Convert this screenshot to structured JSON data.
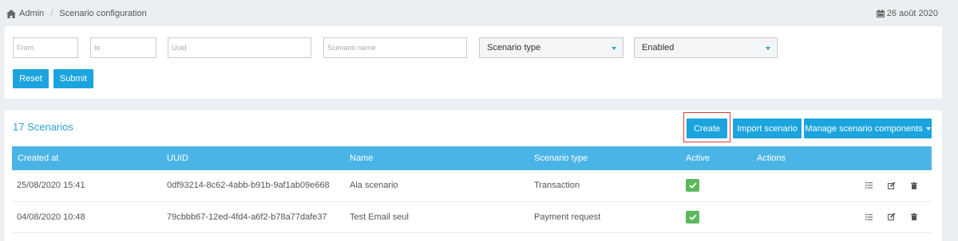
{
  "breadcrumb": {
    "home": "Admin",
    "current": "Scenario configuration"
  },
  "date": "26 août 2020",
  "filters": {
    "from_placeholder": "From",
    "to_placeholder": "to",
    "uuid_placeholder": "Uuid",
    "name_placeholder": "Scenario name",
    "scenario_type": "Scenario type",
    "enabled": "Enabled",
    "reset_label": "Reset",
    "submit_label": "Submit"
  },
  "scenarios": {
    "title": "17 Scenarios",
    "create_label": "Create",
    "import_label": "Import scenario",
    "manage_label": "Manage scenario components",
    "columns": [
      "Created at",
      "UUID",
      "Name",
      "Scenario type",
      "Active",
      "Actions"
    ],
    "rows": [
      {
        "created_at": "25/08/2020 15:41",
        "uuid": "0df93214-8c62-4abb-b91b-9af1ab09e668",
        "name": "Ala scenario",
        "type": "Transaction",
        "active": true
      },
      {
        "created_at": "04/08/2020 10:48",
        "uuid": "79cbbb67-12ed-4fd4-a6f2-b78a77dafe37",
        "name": "Test Email seul",
        "type": "Payment request",
        "active": true
      }
    ]
  },
  "colors": {
    "accent": "#1ba4dd",
    "table_header": "#4bb4e6",
    "active_green": "#5cb85c",
    "highlight_red": "#e53935",
    "title_blue": "#2aa3d8"
  },
  "icons": {
    "home": "home-icon",
    "calendar": "calendar-icon",
    "check": "check-icon",
    "list": "list-icon",
    "edit": "edit-icon",
    "trash": "trash-icon"
  }
}
